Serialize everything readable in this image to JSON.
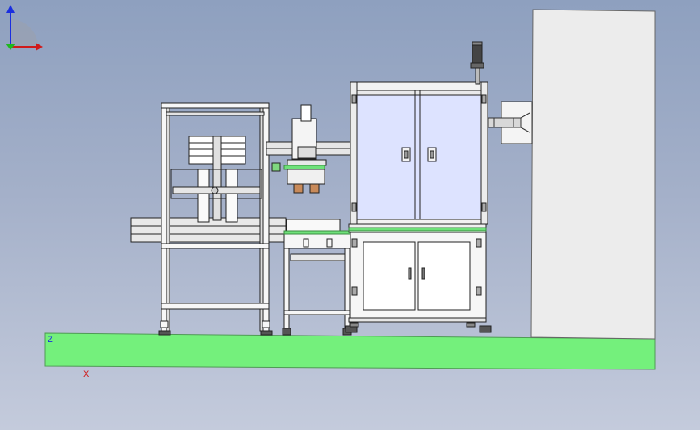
{
  "viewport": {
    "background_top": "#8ea0bf",
    "background_bottom": "#c4cbdc",
    "floor_color": "#74f07c",
    "wall_color": "#ededed"
  },
  "model": {
    "parts": [
      "floor-plane",
      "wall-panel",
      "bottle-loading-frame",
      "conveyor-table",
      "capping-head",
      "enclosed-machine-cabinet",
      "cabinet-base",
      "signal-tower",
      "wall-bracket"
    ]
  },
  "triad": {
    "z_label": "Z",
    "x_label": "X",
    "z_color": "#1a2ee0",
    "x_color": "#d01a1a",
    "y_color": "#1fb81f"
  }
}
